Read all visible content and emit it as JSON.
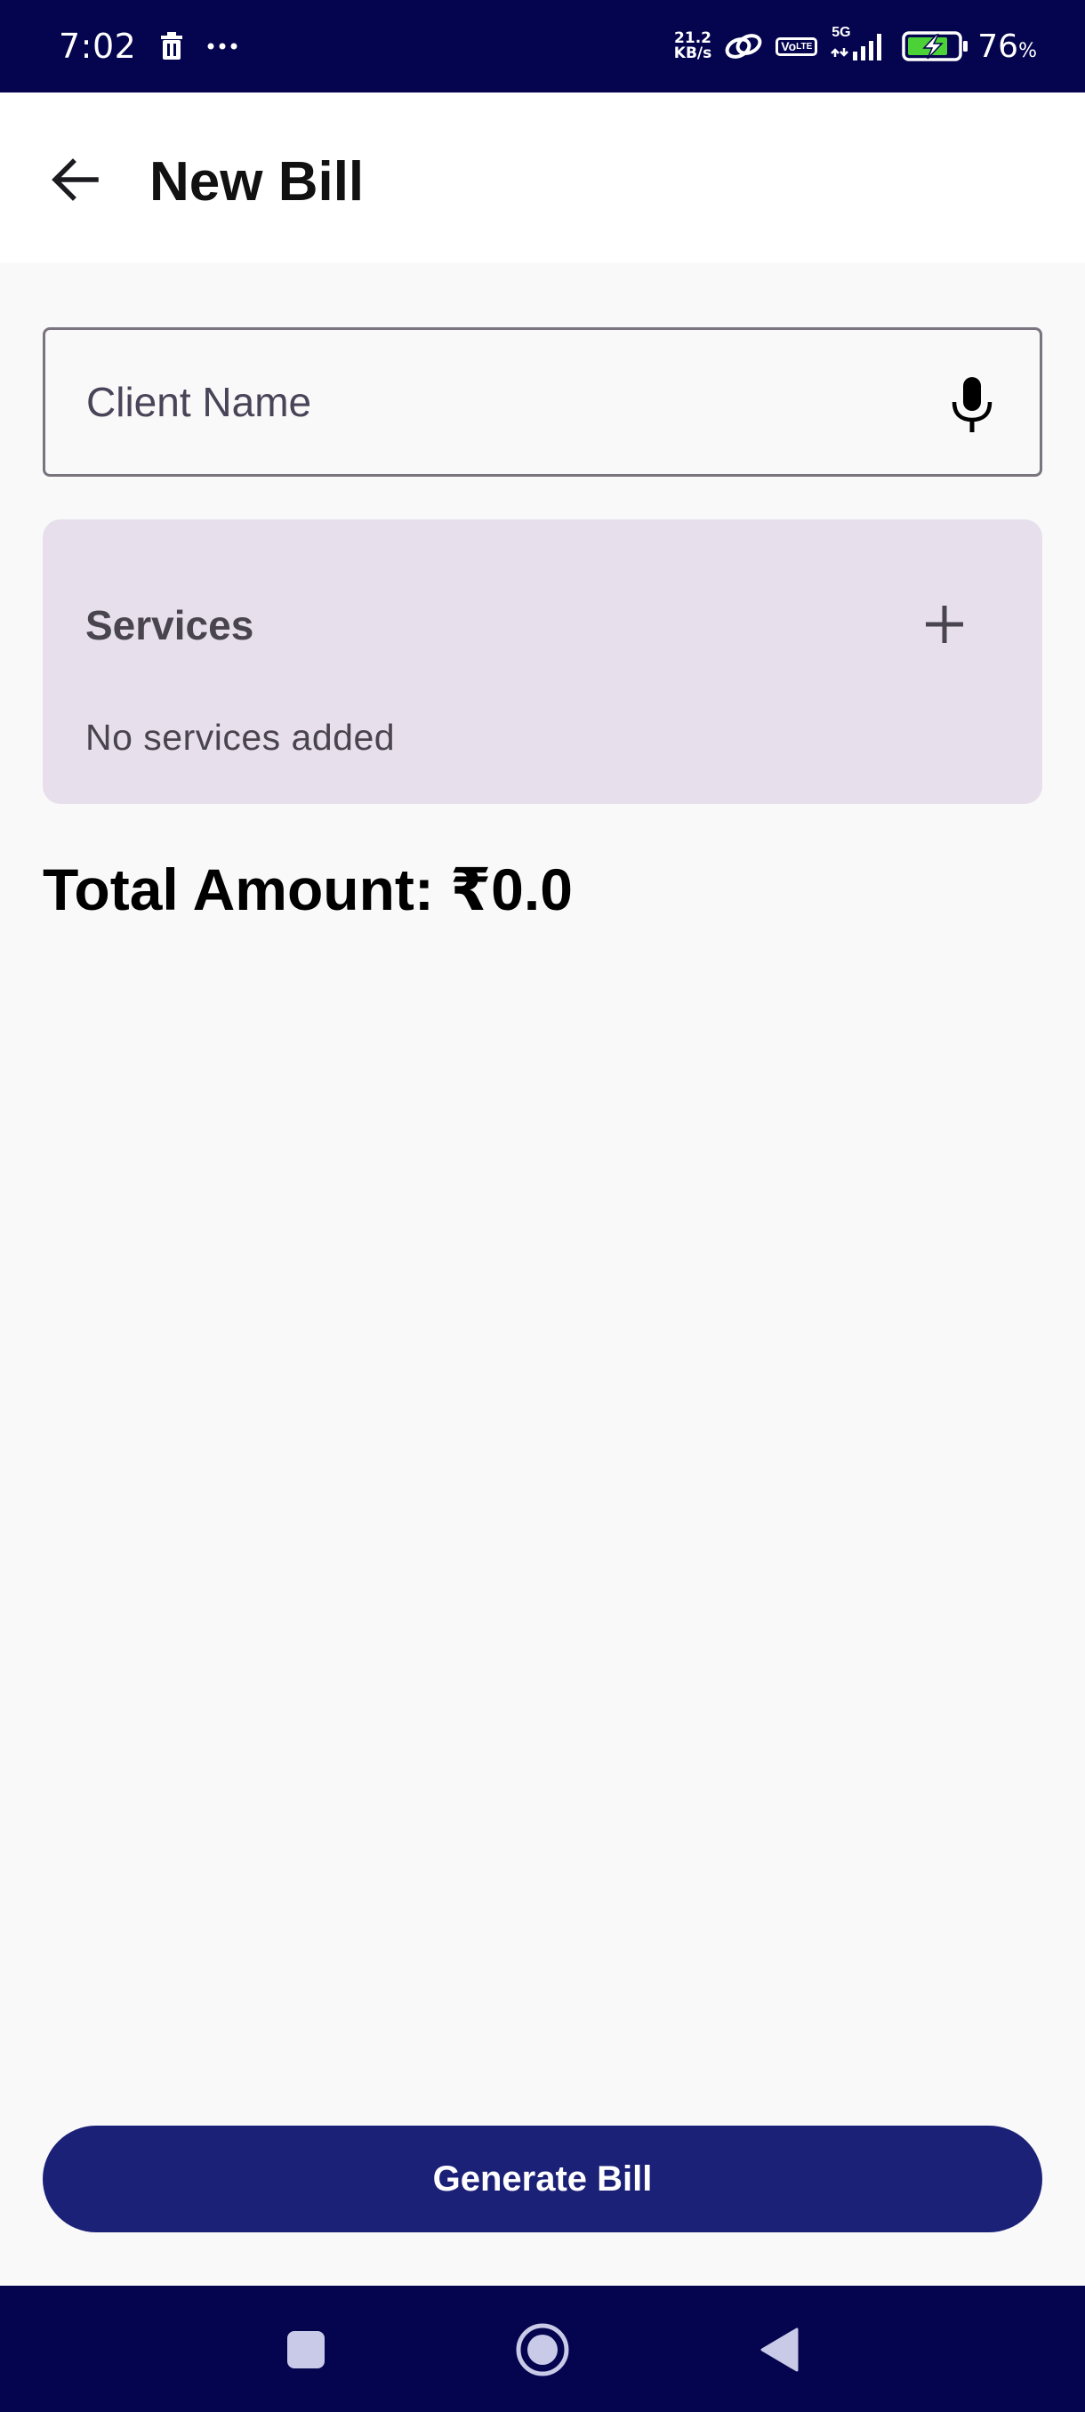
{
  "status_bar": {
    "time": "7:02",
    "net_speed_value": "21.2",
    "net_speed_unit": "KB/s",
    "volte_top": "Vo",
    "volte_bottom": "LTE",
    "network_type": "5G",
    "battery_percent": "76",
    "battery_unit": "%",
    "colors": {
      "background": "#04044f",
      "battery_charge": "#4cd137"
    }
  },
  "app_bar": {
    "title": "New Bill",
    "back_icon": "arrow-back-icon"
  },
  "client_field": {
    "value": "",
    "placeholder": "Client Name",
    "trailing_icon": "mic-icon"
  },
  "services": {
    "title": "Services",
    "add_icon": "plus-icon",
    "empty_text": "No services added",
    "colors": {
      "card_background": "#e7e0ec"
    }
  },
  "total": {
    "label": "Total Amount: ₹0.0"
  },
  "actions": {
    "generate_label": "Generate Bill",
    "colors": {
      "button_background": "#1c2178"
    }
  },
  "nav_bar": {
    "icons": [
      "square-recents-icon",
      "circle-home-icon",
      "triangle-back-icon"
    ]
  }
}
